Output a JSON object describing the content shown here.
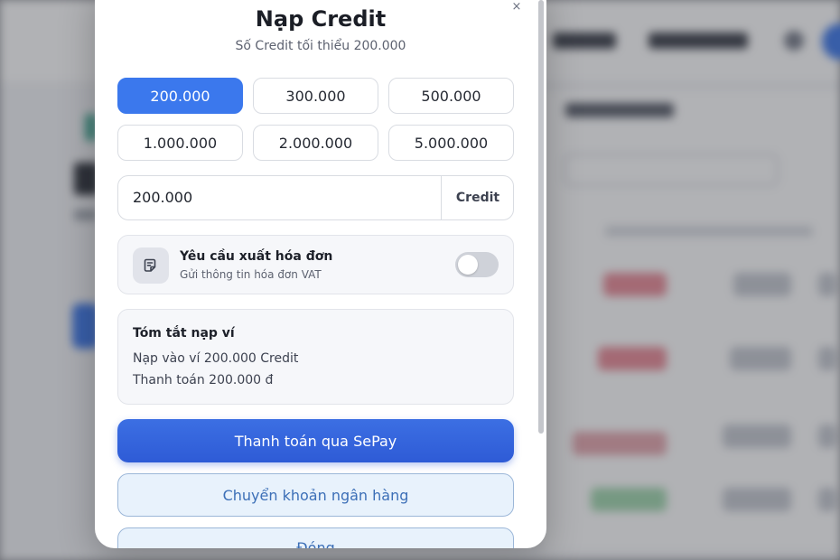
{
  "modal": {
    "title": "Nạp Credit",
    "subtitle": "Số Credit tối thiểu 200.000",
    "close_icon": "×"
  },
  "amounts": {
    "options": [
      "200.000",
      "300.000",
      "500.000",
      "1.000.000",
      "2.000.000",
      "5.000.000"
    ],
    "selected": "200.000"
  },
  "amount_input": {
    "value": "200.000",
    "unit": "Credit"
  },
  "invoice": {
    "icon": "document-icon",
    "title": "Yêu cầu xuất hóa đơn",
    "subtitle": "Gửi thông tin hóa đơn VAT",
    "enabled": false
  },
  "summary": {
    "title": "Tóm tắt nạp ví",
    "line1": "Nạp vào ví 200.000 Credit",
    "line2": "Thanh toán 200.000 đ"
  },
  "actions": {
    "pay_sepay": "Thanh toán qua SePay",
    "bank_transfer": "Chuyển khoản ngân hàng",
    "close": "Đóng"
  },
  "colors": {
    "accent": "#3b78ed",
    "primary_button": "#2e5bd6",
    "secondary_button_bg": "#e8f2fc"
  }
}
